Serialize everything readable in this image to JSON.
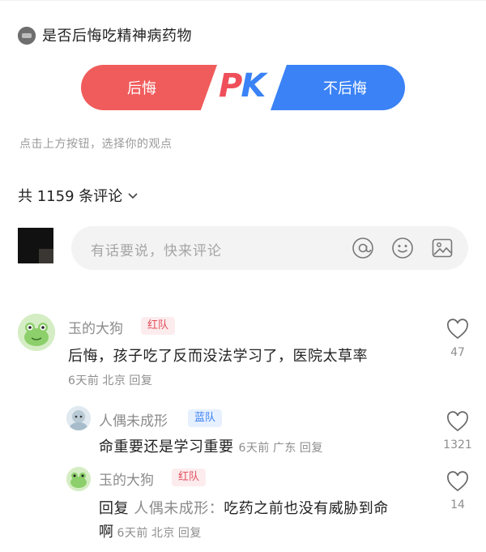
{
  "poll": {
    "title": "是否后悔吃精神病药物",
    "option_left": "后悔",
    "option_right": "不后悔",
    "pk_p": "P",
    "pk_k": "K",
    "hint": "点击上方按钮，选择你的观点"
  },
  "comments_header": {
    "label": "共 1159 条评论"
  },
  "input": {
    "placeholder": "有话要说，快来评论"
  },
  "comments": [
    {
      "user": "玉的大狗",
      "team": "红队",
      "text": "后悔，孩子吃了反而没法学习了，医院太草率",
      "time": "6天前",
      "location": "北京",
      "reply_label": "回复",
      "likes": "47"
    },
    {
      "user": "人偶未成形",
      "team": "蓝队",
      "text": "命重要还是学习重要",
      "time": "6天前",
      "location": "广东",
      "reply_label": "回复",
      "likes": "1321"
    },
    {
      "user": "玉的大狗",
      "team": "红队",
      "reply_prefix": "回复",
      "reply_to": "人偶未成形：",
      "text_line1": "吃药之前也没有威胁到命",
      "text_line2": "啊",
      "time": "6天前",
      "location": "北京",
      "reply_label": "回复",
      "likes": "14"
    }
  ],
  "colors": {
    "red": "#f05c5c",
    "blue": "#3a82f6",
    "gray_text": "#8e8e8e"
  }
}
